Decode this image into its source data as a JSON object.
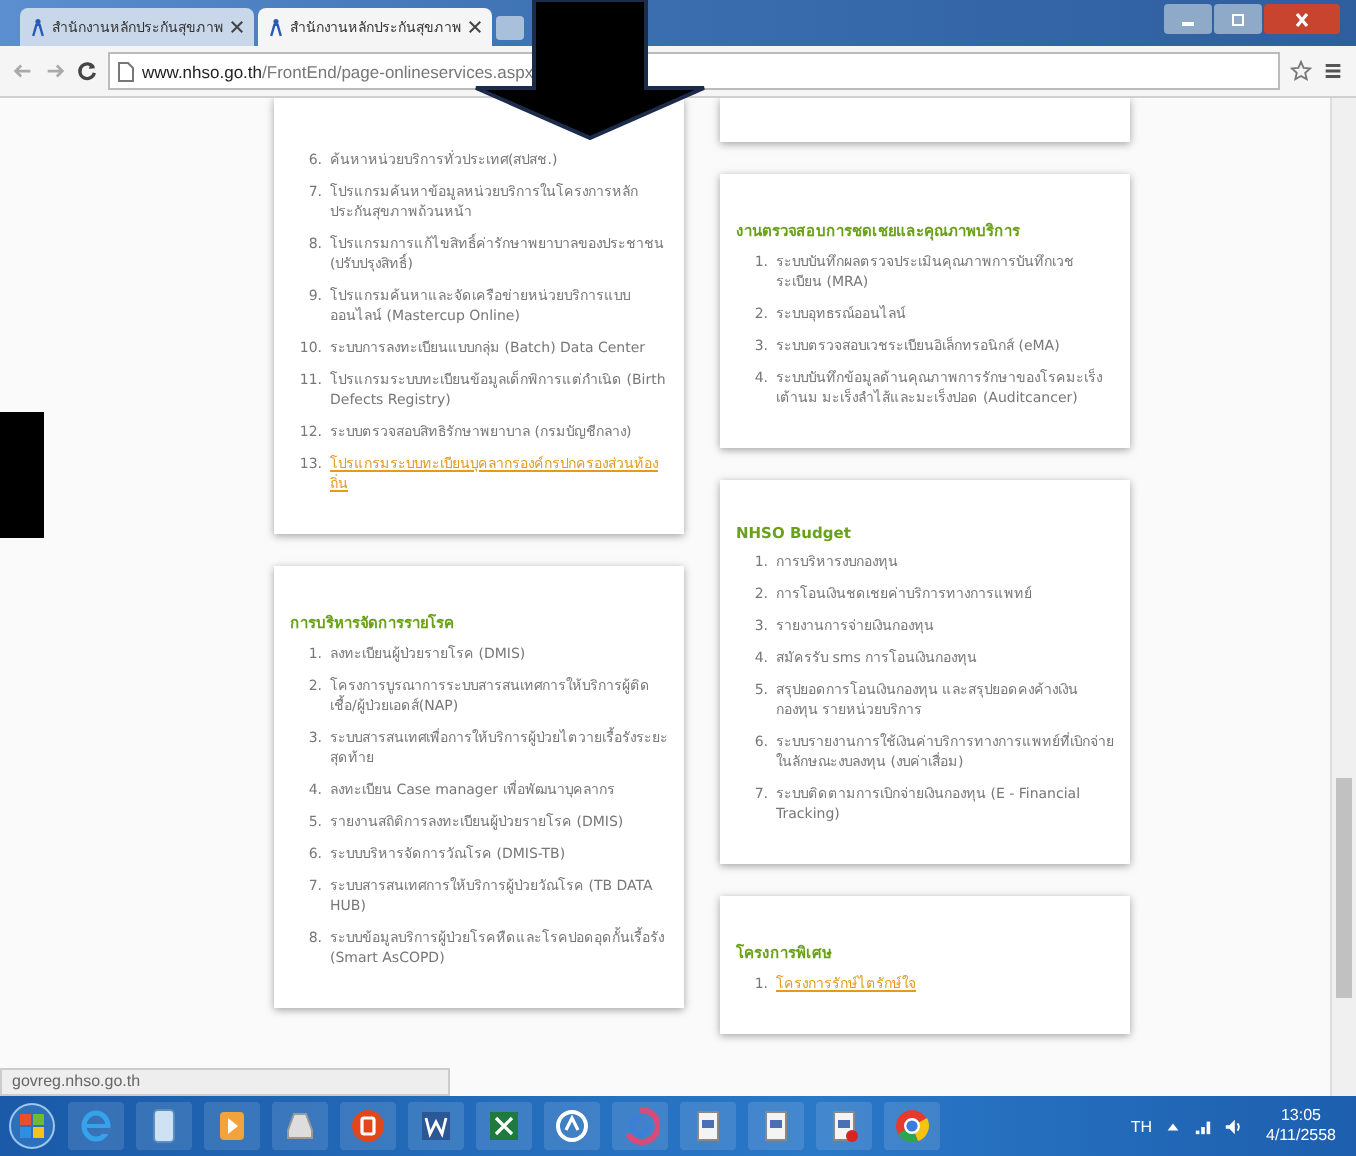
{
  "tabs": [
    {
      "title": "สำนักงานหลักประกันสุขภาพ",
      "selected": false
    },
    {
      "title": "สำนักงานหลักประกันสุขภาพ",
      "selected": true
    }
  ],
  "address_bar": {
    "host": "www.nhso.go.th",
    "path": "/FrontEnd/page-onlineservices.aspx"
  },
  "columns": [
    {
      "cards": [
        {
          "kind": "continued",
          "items": [
            {
              "number": "6.",
              "text": "ค้นหาหน่วยบริการทั่วประเทศ(สปสช.)",
              "kind": "text"
            },
            {
              "number": "7.",
              "text": "โปรแกรมค้นหาข้อมูลหน่วยบริการในโครงการหลักประกันสุขภาพถ้วนหน้า",
              "kind": "text"
            },
            {
              "number": "8.",
              "text": "โปรแกรมการแก้ไขสิทธิ์ค่ารักษาพยาบาลของประชาชน (ปรับปรุงสิทธิ์)",
              "kind": "text"
            },
            {
              "number": "9.",
              "text": "โปรแกรมค้นหาและจัดเครือข่ายหน่วยบริการแบบออนไลน์ (Mastercup Online)",
              "kind": "text"
            },
            {
              "number": "10.",
              "text": "ระบบการลงทะเบียนแบบกลุ่ม (Batch) Data Center",
              "kind": "text"
            },
            {
              "number": "11.",
              "text": "โปรแกรมระบบทะเบียนข้อมูลเด็กพิการแต่กำเนิด (Birth Defects Registry)",
              "kind": "text"
            },
            {
              "number": "12.",
              "text": "ระบบตรวจสอบสิทธิรักษาพยาบาล (กรมบัญชีกลาง)",
              "kind": "text"
            },
            {
              "number": "13.",
              "text": "โปรแกรมระบบทะเบียนบุคลากรองค์กรปกครองส่วนท้องถิ่น",
              "kind": "link"
            }
          ]
        },
        {
          "kind": "full",
          "heading": "การบริหารจัดการรายโรค",
          "items": [
            {
              "number": "1.",
              "text": "ลงทะเบียนผู้ป่วยรายโรค (DMIS)",
              "kind": "text"
            },
            {
              "number": "2.",
              "text": "โครงการบูรณาการระบบสารสนเทศการให้บริการผู้ติดเชื้อ/ผู้ป่วยเอดส์(NAP)",
              "kind": "text"
            },
            {
              "number": "3.",
              "text": "ระบบสารสนเทศเพื่อการให้บริการผู้ป่วยไตวายเรื้อรังระยะสุดท้าย",
              "kind": "text"
            },
            {
              "number": "4.",
              "text": "ลงทะเบียน Case manager เพื่อพัฒนาบุคลากร",
              "kind": "text"
            },
            {
              "number": "5.",
              "text": "รายงานสถิติการลงทะเบียนผู้ป่วยรายโรค (DMIS)",
              "kind": "text"
            },
            {
              "number": "6.",
              "text": "ระบบบริหารจัดการวัณโรค (DMIS-TB)",
              "kind": "text"
            },
            {
              "number": "7.",
              "text": "ระบบสารสนเทศการให้บริการผู้ป่วยวัณโรค (TB DATA HUB)",
              "kind": "text"
            },
            {
              "number": "8.",
              "text": "ระบบข้อมูลบริการผู้ป่วยโรคหืดและโรคปอดอุดกั้นเรื้อรัง (Smart AsCOPD)",
              "kind": "text"
            }
          ]
        }
      ]
    },
    {
      "cards": [
        {
          "kind": "continued"
        },
        {
          "kind": "full",
          "heading": "งานตรวจสอบการชดเชยและคุณภาพบริการ",
          "items": [
            {
              "number": "1.",
              "text": "ระบบบันทึกผลตรวจประเมินคุณภาพการบันทึกเวชระเบียน (MRA)",
              "kind": "text"
            },
            {
              "number": "2.",
              "text": "ระบบอุทธรณ์ออนไลน์",
              "kind": "text"
            },
            {
              "number": "3.",
              "text": "ระบบตรวจสอบเวชระเบียนอิเล็กทรอนิกส์ (eMA)",
              "kind": "text"
            },
            {
              "number": "4.",
              "text": "ระบบบันทึกข้อมูลด้านคุณภาพการรักษาของโรคมะเร็งเต้านม มะเร็งลำไส้และมะเร็งปอด (Auditcancer)",
              "kind": "text"
            }
          ]
        },
        {
          "kind": "full",
          "heading": "NHSO Budget",
          "items": [
            {
              "number": "1.",
              "text": "การบริหารงบกองทุน",
              "kind": "text"
            },
            {
              "number": "2.",
              "text": "การโอนเงินชดเชยค่าบริการทางการแพทย์",
              "kind": "text"
            },
            {
              "number": "3.",
              "text": "รายงานการจ่ายเงินกองทุน",
              "kind": "text"
            },
            {
              "number": "4.",
              "text": "สมัครรับ sms การโอนเงินกองทุน",
              "kind": "text"
            },
            {
              "number": "5.",
              "text": "สรุปยอดการโอนเงินกองทุน และสรุปยอดคงค้างเงินกองทุน รายหน่วยบริการ",
              "kind": "text"
            },
            {
              "number": "6.",
              "text": "ระบบรายงานการใช้เงินค่าบริการทางการแพทย์ที่เบิกจ่ายในลักษณะงบลงทุน (งบค่าเสื่อม)",
              "kind": "text"
            },
            {
              "number": "7.",
              "text": "ระบบติดตามการเบิกจ่ายเงินกองทุน (E - Financial Tracking)",
              "kind": "text"
            }
          ]
        },
        {
          "kind": "full",
          "heading": "โครงการพิเศษ",
          "items": [
            {
              "number": "1.",
              "text": "โครงการรักษ์ไตรักษ์ใจ",
              "kind": "link"
            }
          ]
        }
      ]
    }
  ],
  "status_bar": {
    "url": "govreg.nhso.go.th"
  },
  "taskbar": {
    "language": "TH",
    "time": "13:05",
    "date": "4/11/2558"
  }
}
